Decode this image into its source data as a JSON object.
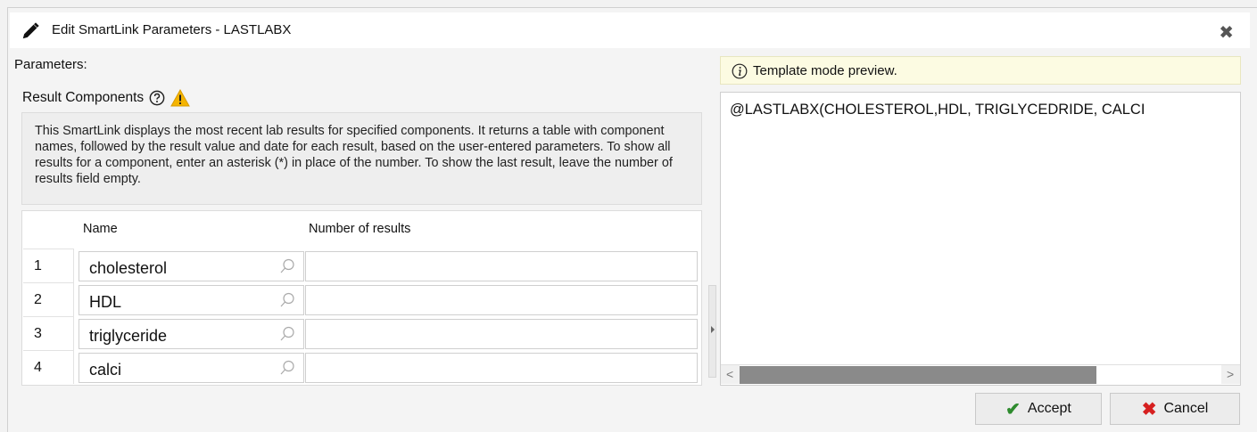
{
  "dialog": {
    "title": "Edit SmartLink Parameters - LASTLABX",
    "close_glyph": "✖"
  },
  "params": {
    "label": "Parameters:",
    "result_components_label": "Result Components",
    "description": "This SmartLink displays the most recent lab results for specified components. It returns a table with component names, followed by the result value and date for each result, based on the user-entered parameters. To show all results for a component, enter an asterisk (*) in place of the number. To show the last result, leave the number of results field empty.",
    "table": {
      "headers": {
        "name": "Name",
        "number": "Number of results"
      },
      "rows": [
        {
          "num": "1",
          "name": "cholesterol",
          "number_of_results": ""
        },
        {
          "num": "2",
          "name": "HDL",
          "number_of_results": ""
        },
        {
          "num": "3",
          "name": "triglyceride",
          "number_of_results": ""
        },
        {
          "num": "4",
          "name": "calci",
          "number_of_results": ""
        }
      ]
    }
  },
  "preview": {
    "banner": "Template mode preview.",
    "text": "@LASTLABX(CHOLESTEROL,HDL, TRIGLYCEDRIDE, CALCI",
    "scroll_fraction": 0.74
  },
  "footer": {
    "accept_label": "Accept",
    "cancel_label": "Cancel"
  },
  "icons": {
    "title": "pencil-icon",
    "help": "help-icon",
    "warning": "warning-icon",
    "info": "info-icon",
    "lookup": "magnifier-icon"
  },
  "colors": {
    "warning": "#f5b400",
    "accept": "#2e8b2e",
    "cancel": "#d62020",
    "banner_bg": "#fcfbe2"
  }
}
